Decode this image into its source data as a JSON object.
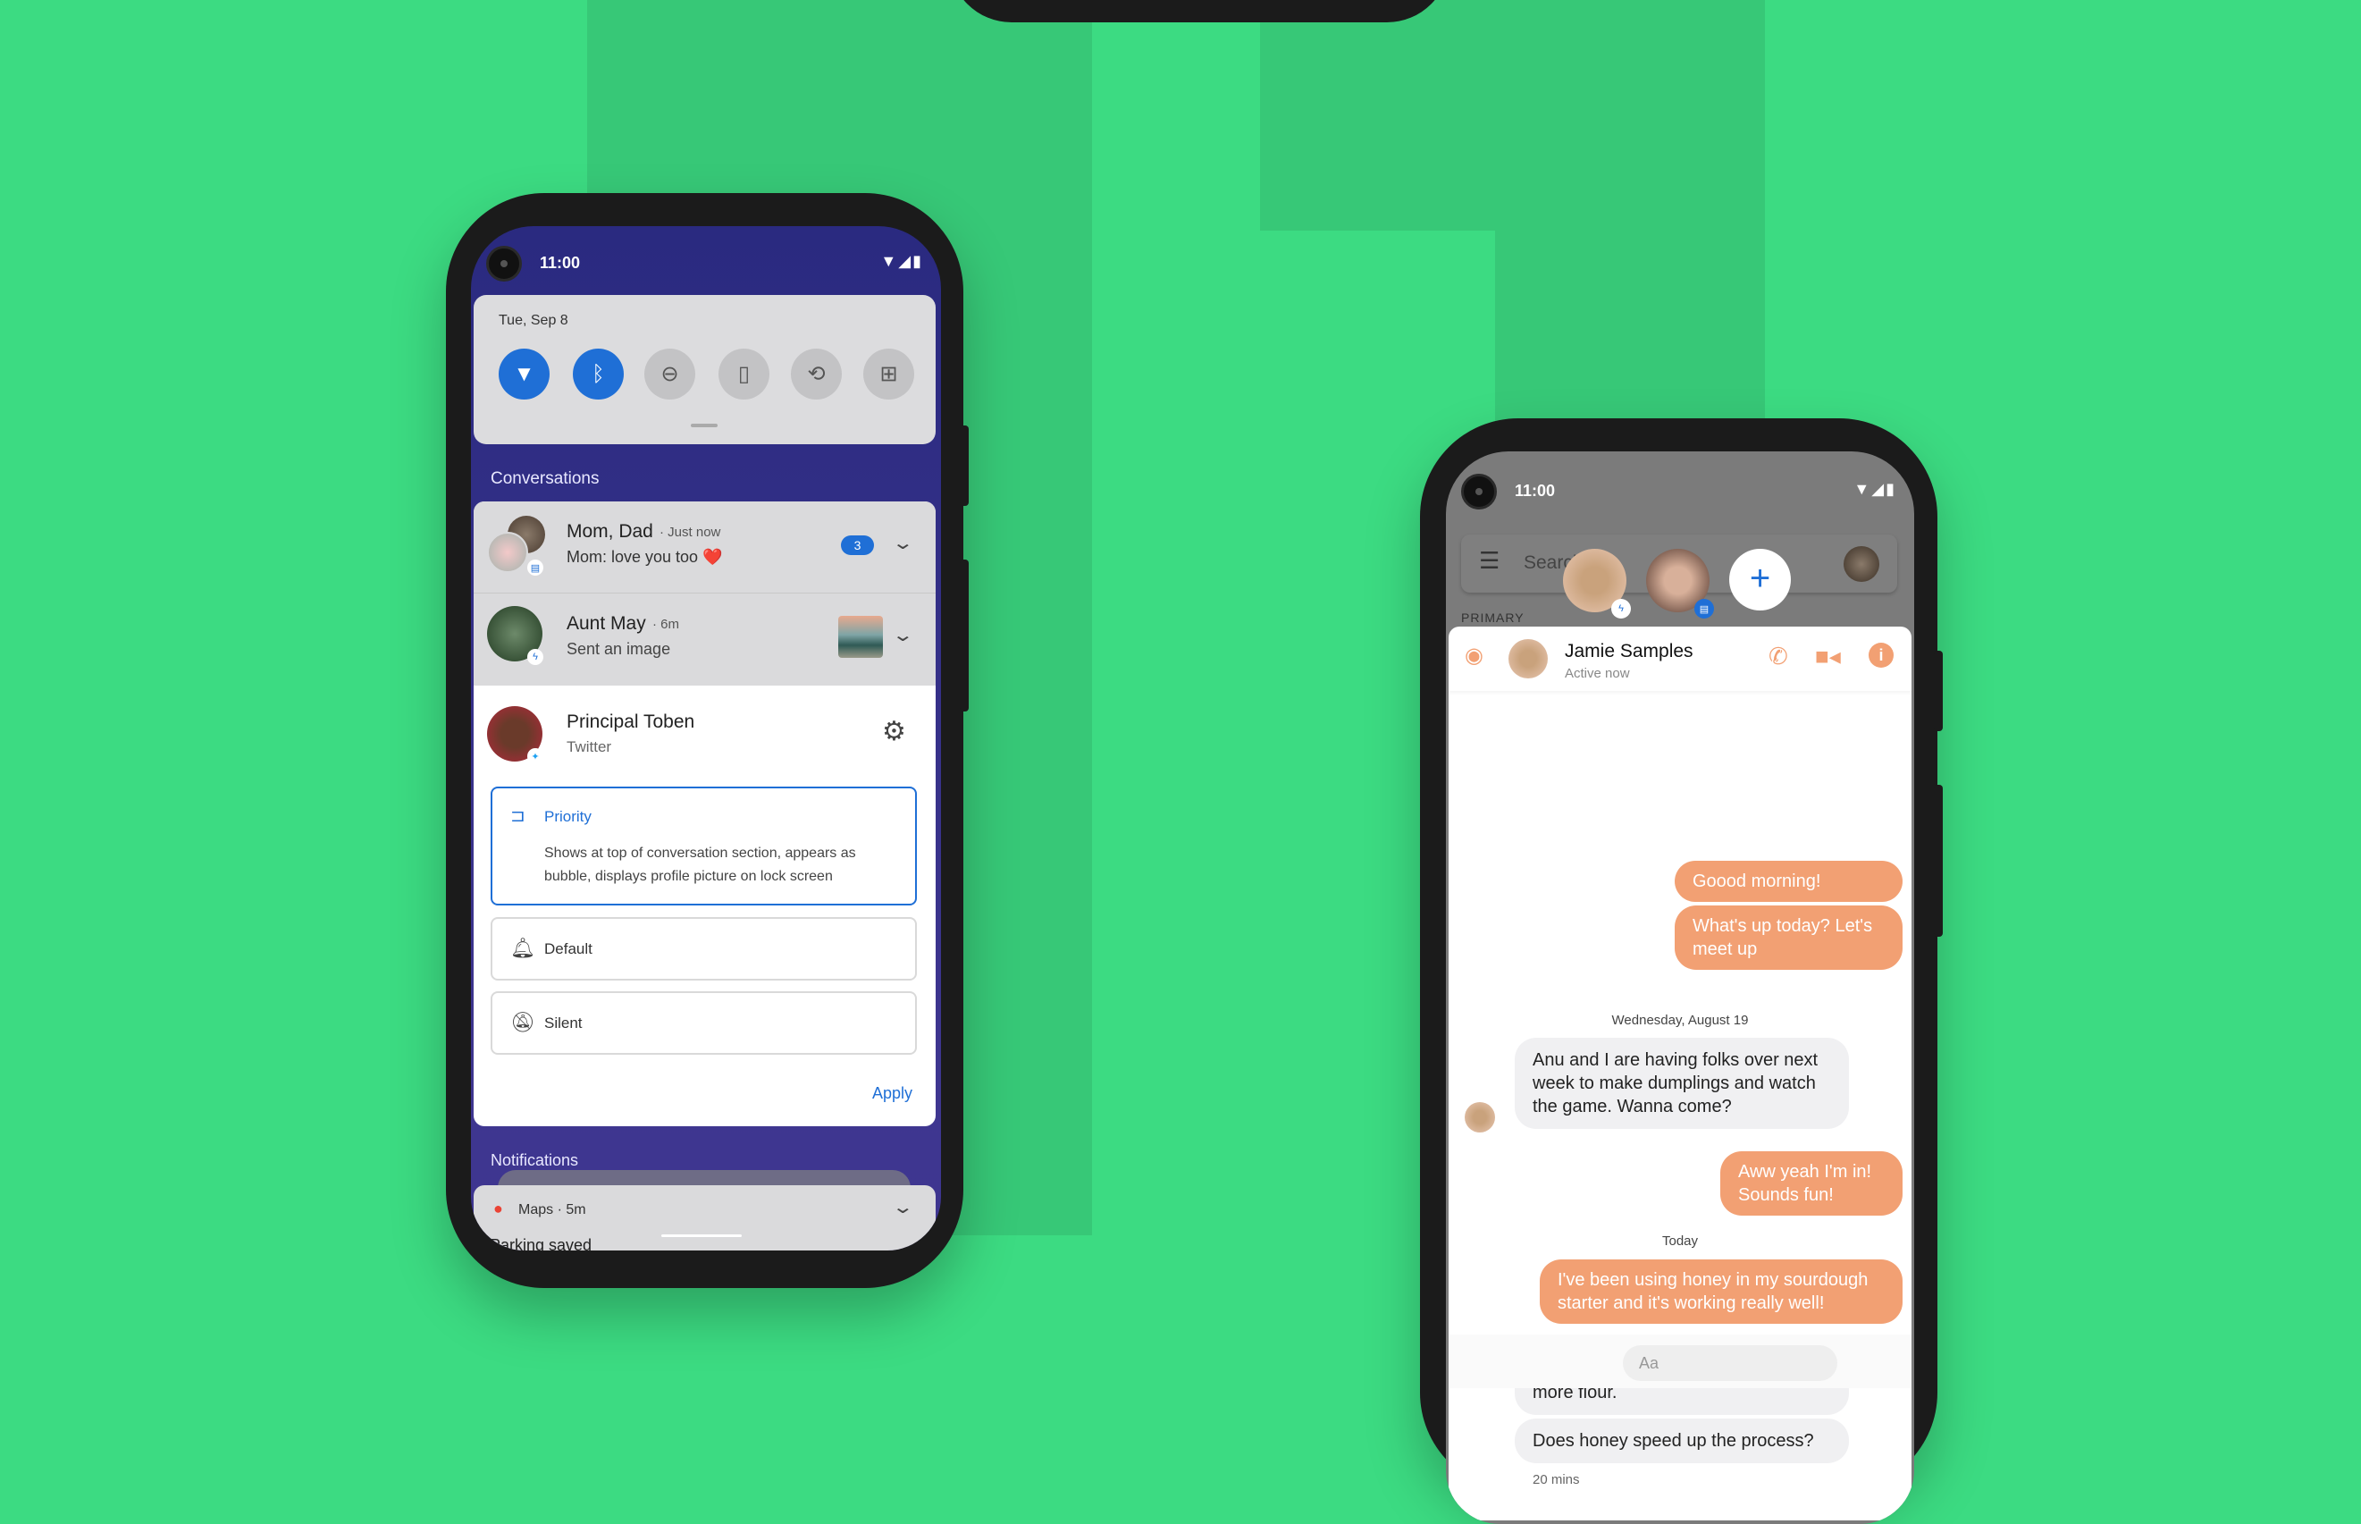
{
  "colors": {
    "background": "#3cdb82",
    "shade": "#37c877",
    "notif_bg": "#2b2a7e",
    "accent_blue": "#1f6fd6",
    "messenger_orange": "#f2a073"
  },
  "left_phone": {
    "status": {
      "time": "11:00"
    },
    "quick_settings": {
      "date": "Tue, Sep 8",
      "tiles": [
        {
          "icon": "wifi-icon",
          "glyph": "▼",
          "on": true
        },
        {
          "icon": "bluetooth-icon",
          "glyph": "ᛒ",
          "on": true
        },
        {
          "icon": "do-not-disturb-icon",
          "glyph": "⊖",
          "on": false
        },
        {
          "icon": "flashlight-icon",
          "glyph": "▯",
          "on": false
        },
        {
          "icon": "auto-rotate-icon",
          "glyph": "⟲",
          "on": false
        },
        {
          "icon": "battery-saver-icon",
          "glyph": "⊞",
          "on": false
        }
      ]
    },
    "conversations_title": "Conversations",
    "conversations": [
      {
        "name": "Mom, Dad",
        "time": "Just now",
        "message": "Mom: love you too ❤️",
        "count": "3"
      },
      {
        "name": "Aunt May",
        "time": "6m",
        "message": "Sent an image"
      }
    ],
    "expanded": {
      "name": "Principal Toben",
      "app": "Twitter",
      "options": [
        {
          "label": "Priority",
          "description": "Shows at top of conversation section, appears as bubble, displays profile picture on lock screen",
          "selected": true
        },
        {
          "label": "Default",
          "selected": false
        },
        {
          "label": "Silent",
          "selected": false
        }
      ],
      "apply": "Apply"
    },
    "notifications_title": "Notifications",
    "maps": {
      "app": "Maps",
      "time": "5m",
      "title": "Parking saved"
    }
  },
  "right_phone": {
    "status": {
      "time": "11:00"
    },
    "search_placeholder": "Search",
    "section": "PRIMARY",
    "chat": {
      "name": "Jamie Samples",
      "status": "Active now",
      "messages": [
        {
          "dir": "out",
          "text": "Goood morning!"
        },
        {
          "dir": "out",
          "text": "What's up today? Let's meet up"
        },
        {
          "dir": "date",
          "text": "Wednesday, August 19"
        },
        {
          "dir": "in",
          "text": "Anu and I are having folks over next week to make dumplings and watch the game. Wanna come?"
        },
        {
          "dir": "out",
          "text": "Aww yeah I'm in! Sounds fun!"
        },
        {
          "dir": "date",
          "text": "Today"
        },
        {
          "dir": "out",
          "text": "I've been using honey in my sourdough starter and it's working really well!"
        },
        {
          "dir": "in",
          "text": "Oh interesting. I've just been adding more flour."
        },
        {
          "dir": "in",
          "text": "Does honey speed up the process?"
        },
        {
          "dir": "meta",
          "text": "20 mins"
        }
      ],
      "compose_placeholder": "Aa"
    }
  }
}
